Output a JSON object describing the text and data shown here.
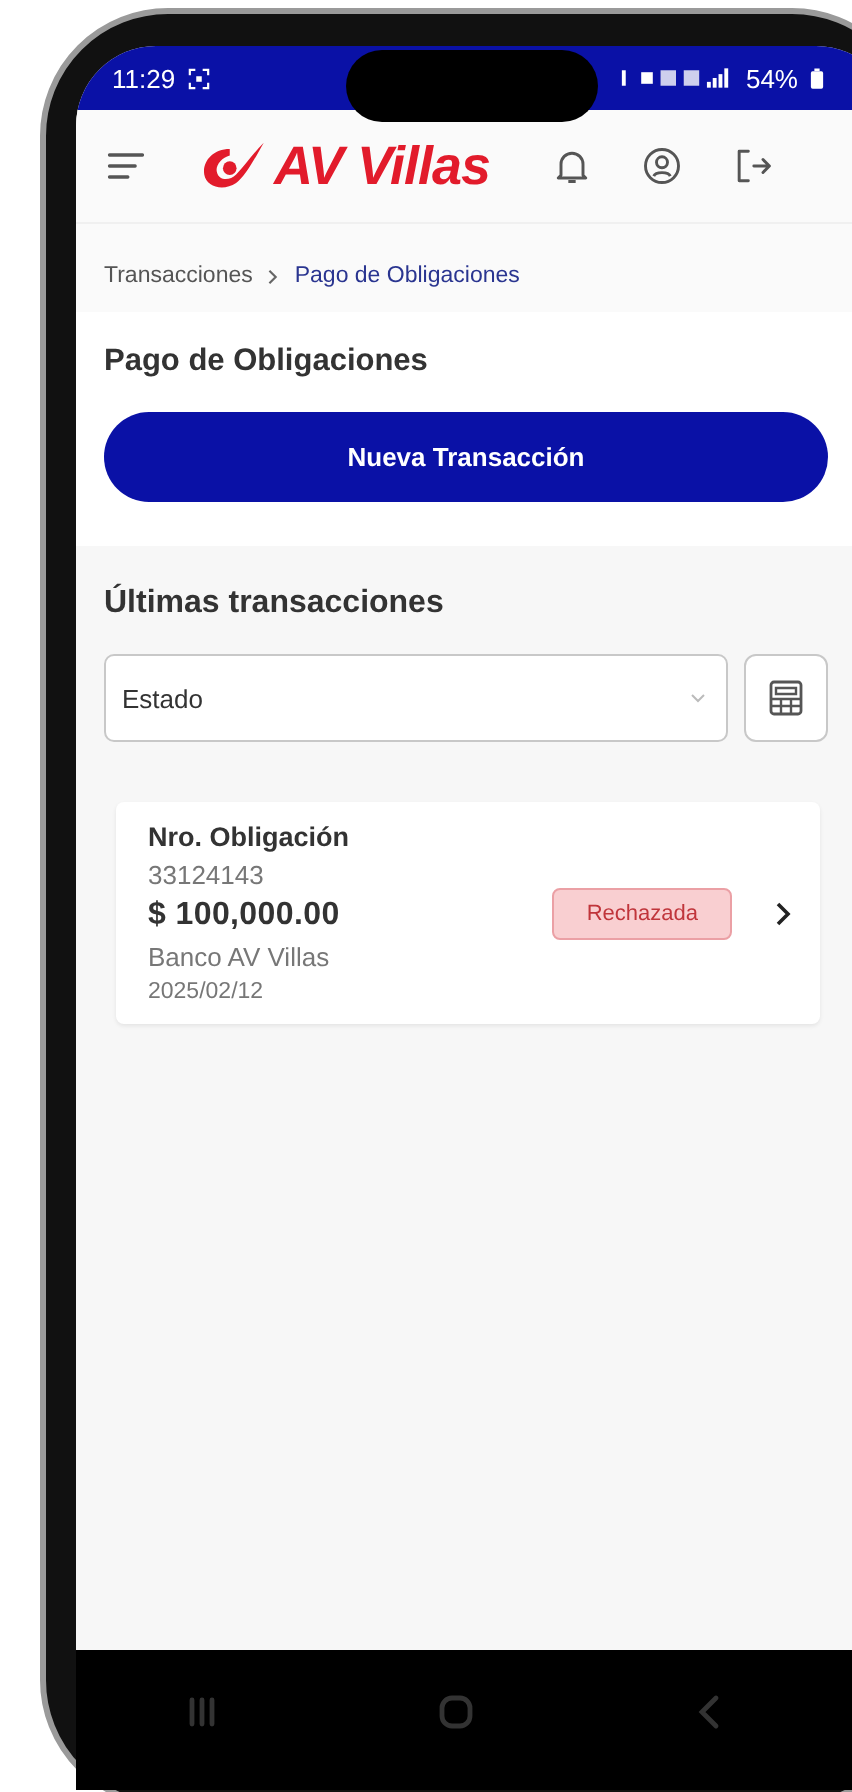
{
  "status_bar": {
    "time": "11:29",
    "battery": "54%"
  },
  "header": {
    "logo": "AV Villas"
  },
  "breadcrumb": [
    {
      "label": "Transacciones",
      "selected": false
    },
    {
      "label": "Pago de Obligaciones",
      "selected": true
    }
  ],
  "page_title": "Pago de Obligaciones",
  "new_transaction_button": "Nueva Transacción",
  "recent": {
    "title": "Últimas transacciones",
    "filter": {
      "placeholder": "Estado"
    }
  },
  "transactions": [
    {
      "label": "Nro. Obligación",
      "number": "33124143",
      "amount": "$ 100,000.00",
      "bank": "Banco AV Villas",
      "date": "2025/02/12",
      "status": {
        "label": "Rechazada",
        "kind": "rejected"
      }
    }
  ]
}
